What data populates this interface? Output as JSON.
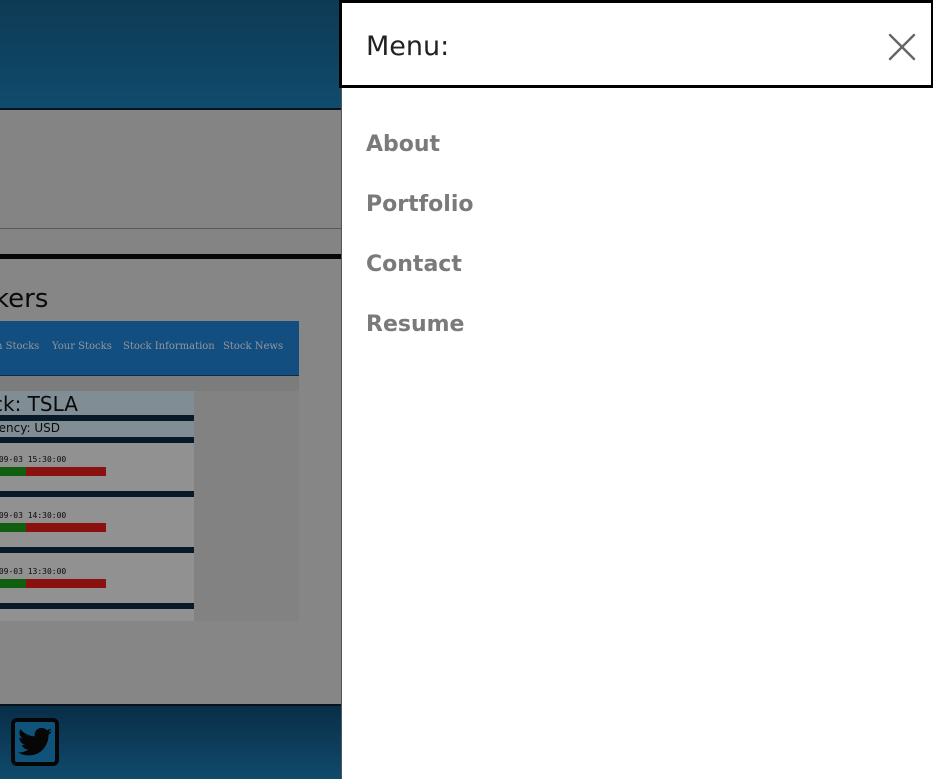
{
  "menu": {
    "title": "Menu:",
    "close_icon": "close-x-icon",
    "items": [
      {
        "label": "About"
      },
      {
        "label": "Portfolio"
      },
      {
        "label": "Contact"
      },
      {
        "label": "Resume"
      }
    ]
  },
  "background": {
    "section_title": "kers",
    "screenshot": {
      "nav": [
        "n Stocks",
        "Your Stocks",
        "Stock Information",
        "Stock News"
      ],
      "ticker": "ck: TSLA",
      "currency": "rency: USD",
      "entries": [
        {
          "time": "-09-03 15:30:00"
        },
        {
          "time": "-09-03 14:30:00"
        },
        {
          "time": "-09-03 13:30:00"
        }
      ]
    },
    "footer_icon": "twitter-icon"
  },
  "colors": {
    "header_blue": "#1a7ab0",
    "menu_text": "#7a7a7a",
    "overlay": "rgba(0,0,0,0.38)"
  }
}
